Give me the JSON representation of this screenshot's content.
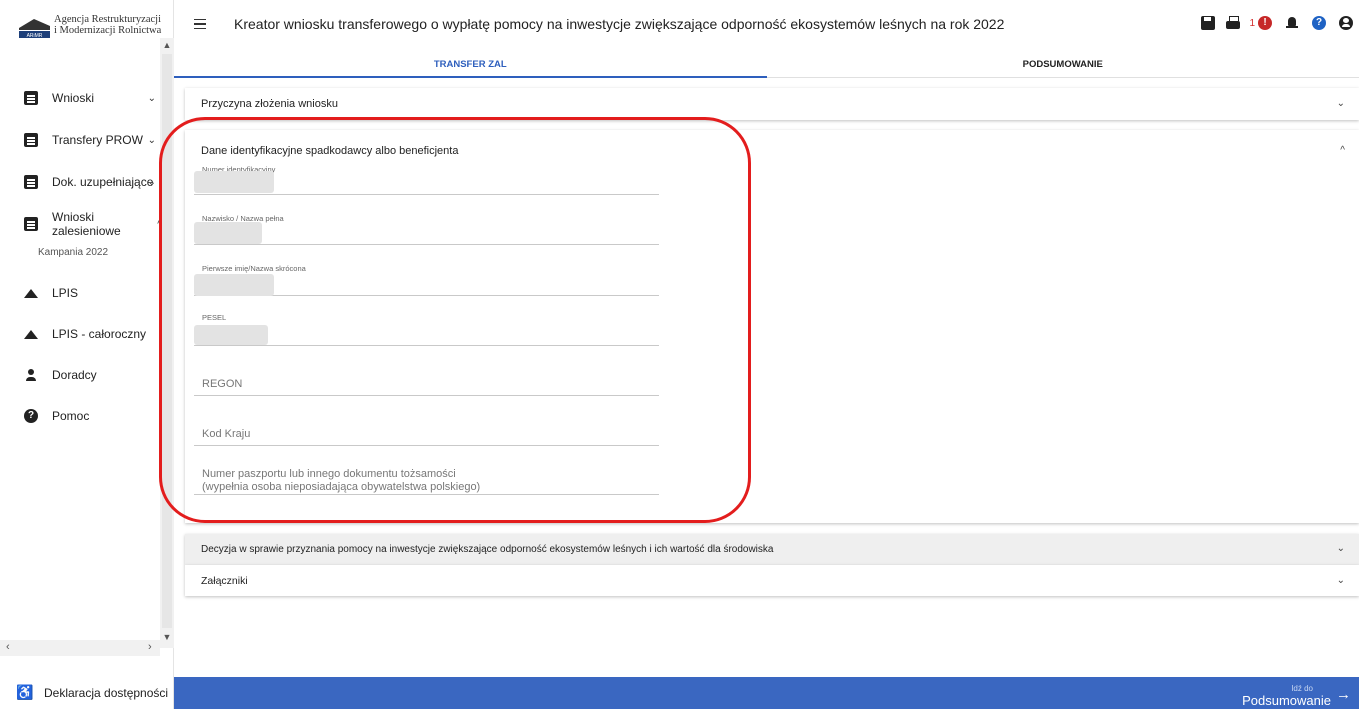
{
  "logo": {
    "line1": "Agencja Restrukturyzacji",
    "line2": "i Modernizacji Rolnictwa",
    "abbrev": "ARiMR"
  },
  "sidebar": {
    "items": [
      {
        "label": "Wnioski",
        "icon": "document-icon",
        "chevron": "⌄"
      },
      {
        "label": "Transfery PROW",
        "icon": "document-icon",
        "chevron": "⌄"
      },
      {
        "label": "Dok. uzupełniające",
        "icon": "document-icon",
        "chevron": "⌄"
      },
      {
        "label": "Wnioski zalesieniowe",
        "icon": "document-icon",
        "chevron": "^"
      },
      {
        "label": "LPIS",
        "icon": "mountain-icon"
      },
      {
        "label": "LPIS - całoroczny",
        "icon": "mountain-icon"
      },
      {
        "label": "Doradcy",
        "icon": "person-icon"
      },
      {
        "label": "Pomoc",
        "icon": "help-icon"
      }
    ],
    "sub_item": "Kampania 2022",
    "accessibility": "Deklaracja dostępności"
  },
  "header": {
    "title": "Kreator wniosku transferowego o wypłatę pomocy na inwestycje zwiększające odporność ekosystemów leśnych na rok 2022",
    "notification_count": "1"
  },
  "tabs": [
    {
      "label": "TRANSFER ZAL",
      "active": true
    },
    {
      "label": "PODSUMOWANIE",
      "active": false
    }
  ],
  "panels": {
    "reason": "Przyczyna złożenia wniosku",
    "identity": "Dane identyfikacyjne spadkodawcy albo beneficjenta",
    "decision": "Decyzja w sprawie przyznania pomocy na inwestycje zwiększające odporność ekosystemów leśnych i ich wartość dla środowiska",
    "attachments": "Załączniki"
  },
  "fields": {
    "id_number": "Numer identyfikacyjny",
    "surname": "Nazwisko / Nazwa pełna",
    "first_name": "Pierwsze imię/Nazwa skrócona",
    "pesel": "PESEL",
    "regon": "REGON",
    "country_code": "Kod Kraju",
    "passport_line1": "Numer paszportu lub innego dokumentu tożsamości",
    "passport_line2": "(wypełnia osoba nieposiadająca obywatelstwa polskiego)"
  },
  "footer": {
    "goto": "Idź do",
    "destination": "Podsumowanie"
  },
  "colors": {
    "accent": "#3a67c1",
    "highlight": "#e31d1d",
    "alert": "#c62828"
  }
}
